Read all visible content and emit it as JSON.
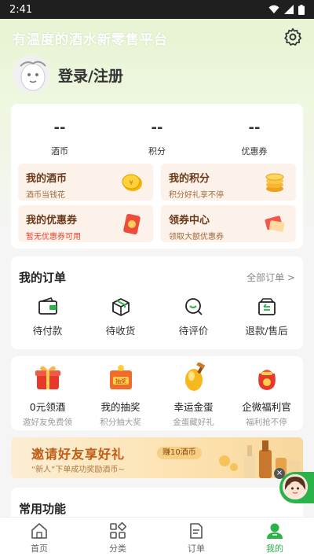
{
  "status_bar": {
    "time": "2:41"
  },
  "header": {
    "slogan": "有温度的酒水新零售平台",
    "login_label": "登录/注册"
  },
  "stats": [
    {
      "value": "--",
      "label": "酒币"
    },
    {
      "value": "--",
      "label": "积分"
    },
    {
      "value": "--",
      "label": "优惠券"
    }
  ],
  "tiles": [
    {
      "title": "我的酒币",
      "subtitle": "酒币当钱花"
    },
    {
      "title": "我的积分",
      "subtitle": "积分好礼享不停"
    },
    {
      "title": "我的优惠券",
      "subtitle": "暂无优惠券可用"
    },
    {
      "title": "领券中心",
      "subtitle": "领取大额优惠券"
    }
  ],
  "orders": {
    "title": "我的订单",
    "more": "全部订单 >",
    "items": [
      {
        "label": "待付款",
        "icon": "wallet-icon"
      },
      {
        "label": "待收货",
        "icon": "box-icon"
      },
      {
        "label": "待评价",
        "icon": "review-icon"
      },
      {
        "label": "退款/售后",
        "icon": "refund-icon"
      }
    ]
  },
  "promos": [
    {
      "title": "0元领酒",
      "subtitle": "邀好友免费领",
      "icon": "gift-icon"
    },
    {
      "title": "我的抽奖",
      "subtitle": "积分抽大奖",
      "icon": "lottery-icon"
    },
    {
      "title": "幸运金蛋",
      "subtitle": "金蛋藏好礼",
      "icon": "golden-egg-icon"
    },
    {
      "title": "企微福利官",
      "subtitle": "福利抢不停",
      "icon": "lucky-bag-icon"
    }
  ],
  "banner": {
    "title": "邀请好友享好礼",
    "badge": "赚10酒币",
    "subtitle": "“新人”下单成功奖励酒币~"
  },
  "common": {
    "title": "常用功能"
  },
  "tabs": [
    {
      "label": "首页",
      "icon": "home-icon"
    },
    {
      "label": "分类",
      "icon": "category-icon"
    },
    {
      "label": "订单",
      "icon": "order-icon"
    },
    {
      "label": "我的",
      "icon": "profile-icon"
    }
  ],
  "colors": {
    "accent": "#2bb34a",
    "tile_bg": "#fdf2ea",
    "tile_title": "#6a3a1a",
    "warn": "#e8432e"
  }
}
